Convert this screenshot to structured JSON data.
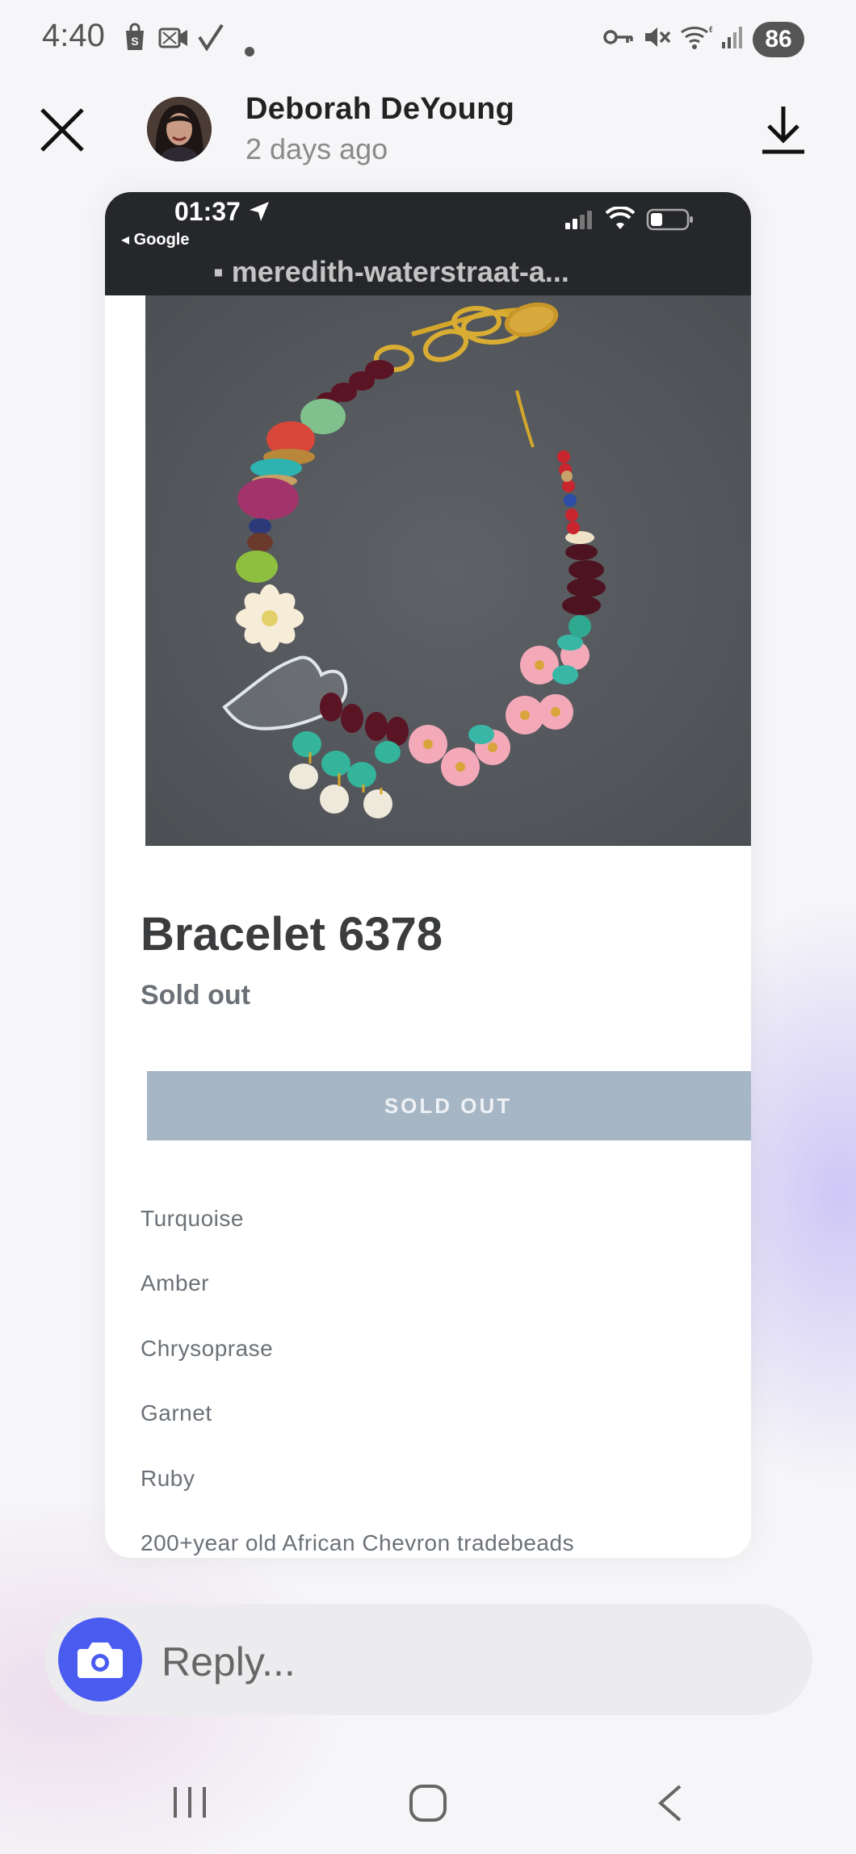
{
  "status_bar": {
    "time": "4:40",
    "left_icons": [
      "shopping-bag-icon",
      "video-call-icon",
      "check-icon",
      "dot-icon"
    ],
    "right_icons": [
      "vpn-key-icon",
      "mute-icon",
      "wifi-icon",
      "signal-icon"
    ],
    "battery": "86"
  },
  "header": {
    "close_icon": "close-icon",
    "sender_name": "Deborah DeYoung",
    "sent_time": "2 days ago",
    "download_icon": "download-icon"
  },
  "story": {
    "inner_status": {
      "time": "01:37",
      "back_label": "◂ Google"
    },
    "url_text": "▪ meredith-waterstraat-a...",
    "product": {
      "image": "bracelet-photo",
      "title": "Bracelet 6378",
      "status": "Sold out",
      "button_label": "SOLD OUT",
      "materials": [
        "Turquoise",
        "Amber",
        "Chrysoprase",
        "Garnet",
        "Ruby",
        "200+year old African Chevron tradebeads"
      ]
    }
  },
  "reply": {
    "placeholder": "Reply..."
  },
  "nav": {
    "recents_icon": "recents-icon",
    "home_icon": "home-icon",
    "back_icon": "back-icon"
  },
  "colors": {
    "accent": "#4a5cf0",
    "soldout_button": "#a7b6c4",
    "card_status_bg": "#25272a"
  }
}
